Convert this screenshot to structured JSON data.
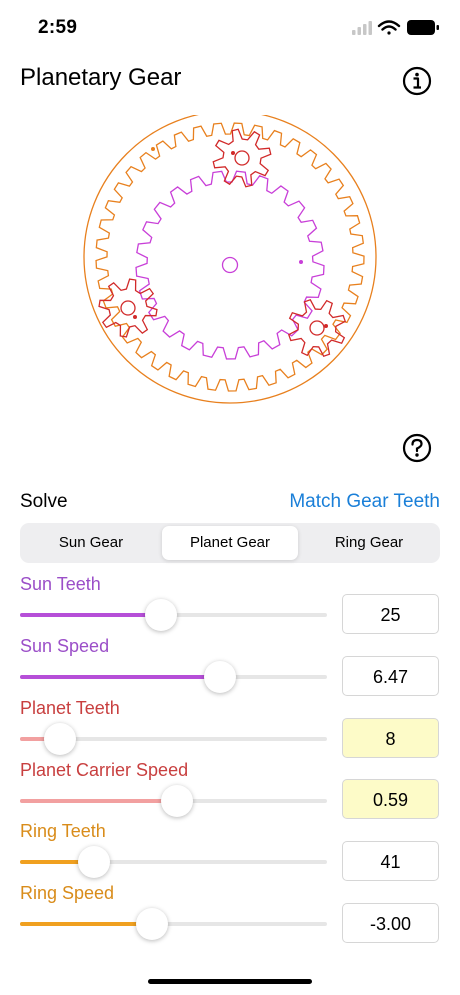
{
  "status_bar": {
    "time": "2:59"
  },
  "header": {
    "title": "Planetary Gear"
  },
  "solve": {
    "label": "Solve",
    "match_link": "Match Gear Teeth"
  },
  "segments": [
    {
      "label": "Sun Gear",
      "selected": false
    },
    {
      "label": "Planet Gear",
      "selected": true
    },
    {
      "label": "Ring Gear",
      "selected": false
    }
  ],
  "params": [
    {
      "label": "Sun Teeth",
      "value": "25",
      "slider_fraction": 0.46,
      "color": "#9b4fc8",
      "fill_color": "#b64fd8",
      "highlighted": false
    },
    {
      "label": "Sun Speed",
      "value": "6.47",
      "slider_fraction": 0.65,
      "color": "#9b4fc8",
      "fill_color": "#b64fd8",
      "highlighted": false
    },
    {
      "label": "Planet Teeth",
      "value": "8",
      "slider_fraction": 0.13,
      "color": "#c83f3f",
      "fill_color": "#f2a0a0",
      "highlighted": true
    },
    {
      "label": "Planet Carrier Speed",
      "value": "0.59",
      "slider_fraction": 0.51,
      "color": "#c83f3f",
      "fill_color": "#f2a0a0",
      "highlighted": true
    },
    {
      "label": "Ring Teeth",
      "value": "41",
      "slider_fraction": 0.24,
      "color": "#d98c1a",
      "fill_color": "#f0a020",
      "highlighted": false
    },
    {
      "label": "Ring Speed",
      "value": "-3.00",
      "slider_fraction": 0.43,
      "color": "#d98c1a",
      "fill_color": "#f0a020",
      "highlighted": false
    }
  ],
  "colors": {
    "sun": "#c83fd8",
    "planet": "#d12a2a",
    "ring": "#e8801e",
    "link": "#1a7fd8",
    "highlight_bg": "#fdfbc8"
  },
  "icons": {
    "info": "info-circle-icon",
    "help": "question-circle-icon"
  }
}
